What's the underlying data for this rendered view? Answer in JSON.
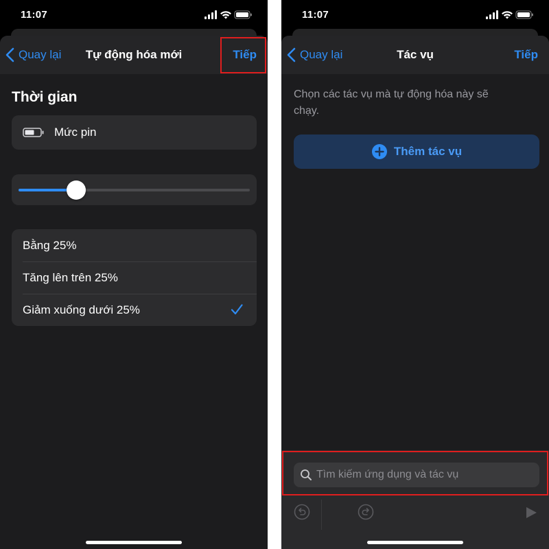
{
  "status_bar": {
    "time": "11:07"
  },
  "left_screen": {
    "nav": {
      "back_label": "Quay lại",
      "title": "Tự động hóa mới",
      "next_label": "Tiếp"
    },
    "section_title": "Thời gian",
    "condition": {
      "label": "Mức pin",
      "icon": "battery-icon"
    },
    "slider": {
      "value_percent": 25
    },
    "options": [
      {
        "label": "Bằng 25%",
        "selected": false
      },
      {
        "label": "Tăng lên trên 25%",
        "selected": false
      },
      {
        "label": "Giảm xuống dưới 25%",
        "selected": true
      }
    ]
  },
  "right_screen": {
    "nav": {
      "back_label": "Quay lại",
      "title": "Tác vụ",
      "next_label": "Tiếp"
    },
    "description": "Chọn các tác vụ mà tự động hóa này sẽ chạy.",
    "add_action_label": "Thêm tác vụ",
    "search": {
      "placeholder": "Tìm kiếm ứng dụng và tác vụ",
      "value": ""
    },
    "toolbar": [
      "undo-icon",
      "redo-icon",
      "play-icon"
    ]
  },
  "colors": {
    "accent": "#2f8cf3",
    "highlight": "#e01e1e",
    "background": "#1c1c1e",
    "card": "#2c2c2e"
  }
}
